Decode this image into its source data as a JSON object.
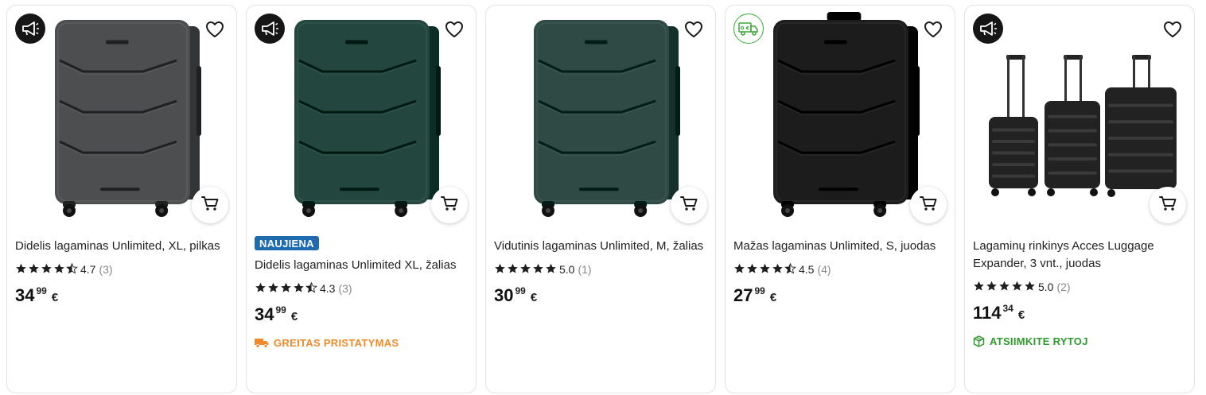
{
  "products": [
    {
      "badge": "megaphone-icon",
      "badge_style": "dark",
      "color": "#4c4e50",
      "suitcase": "single",
      "tag": "",
      "title": "Didelis lagaminas Unlimited, XL, pilkas",
      "stars": 4.5,
      "rating": "4.7",
      "reviews": "(3)",
      "price_int": "34",
      "price_dec": "99",
      "currency": "€",
      "delivery": "",
      "delivery_style": ""
    },
    {
      "badge": "megaphone-icon",
      "badge_style": "dark",
      "color": "#23473f",
      "suitcase": "single",
      "tag": "NAUJIENA",
      "title": "Didelis lagaminas Unlimited XL, žalias",
      "stars": 4.5,
      "rating": "4.3",
      "reviews": "(3)",
      "price_int": "34",
      "price_dec": "99",
      "currency": "€",
      "delivery": "GREITAS PRISTATYMAS",
      "delivery_style": "orange"
    },
    {
      "badge": "",
      "badge_style": "",
      "color": "#2f4a45",
      "suitcase": "single",
      "tag": "",
      "title": "Vidutinis lagaminas Unlimited, M, žalias",
      "stars": 5,
      "rating": "5.0",
      "reviews": "(1)",
      "price_int": "30",
      "price_dec": "99",
      "currency": "€",
      "delivery": "",
      "delivery_style": ""
    },
    {
      "badge": "free-delivery-truck-icon",
      "badge_style": "green",
      "color": "#1c1c1c",
      "suitcase": "single",
      "tag": "",
      "title": "Mažas lagaminas Unlimited, S, juodas",
      "stars": 4.5,
      "rating": "4.5",
      "reviews": "(4)",
      "price_int": "27",
      "price_dec": "99",
      "currency": "€",
      "delivery": "",
      "delivery_style": ""
    },
    {
      "badge": "megaphone-icon",
      "badge_style": "dark",
      "color": "#222222",
      "suitcase": "set",
      "tag": "",
      "title": "Lagaminų rinkinys Acces Luggage Expander, 3 vnt., juodas",
      "stars": 5,
      "rating": "5.0",
      "reviews": "(2)",
      "price_int": "114",
      "price_dec": "34",
      "currency": "€",
      "delivery": "ATSIIMKITE RYTOJ",
      "delivery_style": "green"
    }
  ],
  "icons": {
    "favorite": "heart-outline-icon",
    "add_to_cart": "cart-icon",
    "free_delivery_text": "0 €"
  }
}
